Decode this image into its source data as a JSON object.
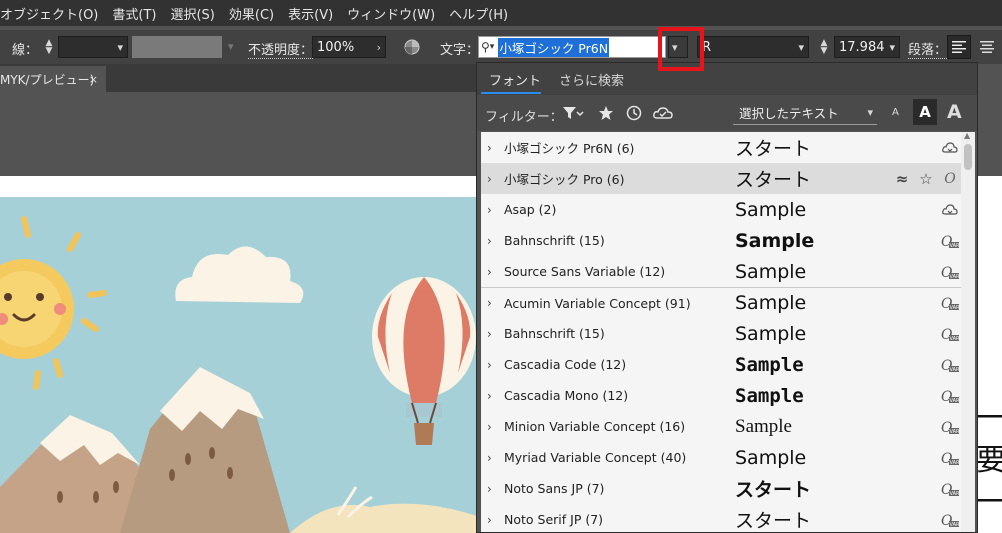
{
  "menu": [
    "オブジェクト(O)",
    "書式(T)",
    "選択(S)",
    "効果(C)",
    "表示(V)",
    "ウィンドウ(W)",
    "ヘルプ(H)"
  ],
  "controlbar": {
    "stroke_label": "線：",
    "opacity_label": "不透明度：",
    "opacity_value": "100%",
    "character_label": "文字：",
    "font_value": "小塚ゴシック Pr6N",
    "style_value": "R",
    "size_value": "17.984",
    "paragraph_label": "段落："
  },
  "document_tab": {
    "label": "MYK/プレビュー)",
    "close": "×"
  },
  "font_panel": {
    "tabs": [
      "フォント",
      "さらに検索"
    ],
    "filter_label": "フィルター：",
    "show_select": "選択したテキスト",
    "size_buttons": [
      "A",
      "A",
      "A"
    ],
    "fonts": [
      {
        "name": "小塚ゴシック Pr6N (6)",
        "sample": "スタート",
        "icon": "cloud-sync-icon"
      },
      {
        "name": "小塚ゴシック Pro (6)",
        "sample": "スタート",
        "icon": "variable-font-icon"
      },
      {
        "name": "Asap (2)",
        "sample": "Sample",
        "icon": "cloud-sync-icon"
      },
      {
        "name": "Bahnschrift (15)",
        "sample": "Sample",
        "icon": "variable-font-icon"
      },
      {
        "name": "Source Sans Variable (12)",
        "sample": "Sample",
        "icon": "variable-font-icon"
      },
      {
        "name": "Acumin Variable Concept (91)",
        "sample": "Sample",
        "icon": "variable-font-icon"
      },
      {
        "name": "Bahnschrift (15)",
        "sample": "Sample",
        "icon": "variable-font-icon"
      },
      {
        "name": "Cascadia Code (12)",
        "sample": "Sample",
        "icon": "variable-font-icon"
      },
      {
        "name": "Cascadia Mono (12)",
        "sample": "Sample",
        "icon": "variable-font-icon"
      },
      {
        "name": "Minion Variable Concept (16)",
        "sample": "Sample",
        "icon": "variable-font-icon"
      },
      {
        "name": "Myriad Variable Concept (40)",
        "sample": "Sample",
        "icon": "variable-font-icon"
      },
      {
        "name": "Noto Sans JP (7)",
        "sample": "スタート",
        "icon": "variable-font-icon"
      },
      {
        "name": "Noto Serif JP (7)",
        "sample": "スタート",
        "icon": "variable-font-icon"
      }
    ]
  },
  "artboard_text": [
    "一",
    "要",
    "一"
  ],
  "colors": {
    "highlight": "#e8141c",
    "selection_blue": "#2d8ceb",
    "panel_dark": "#535353"
  }
}
